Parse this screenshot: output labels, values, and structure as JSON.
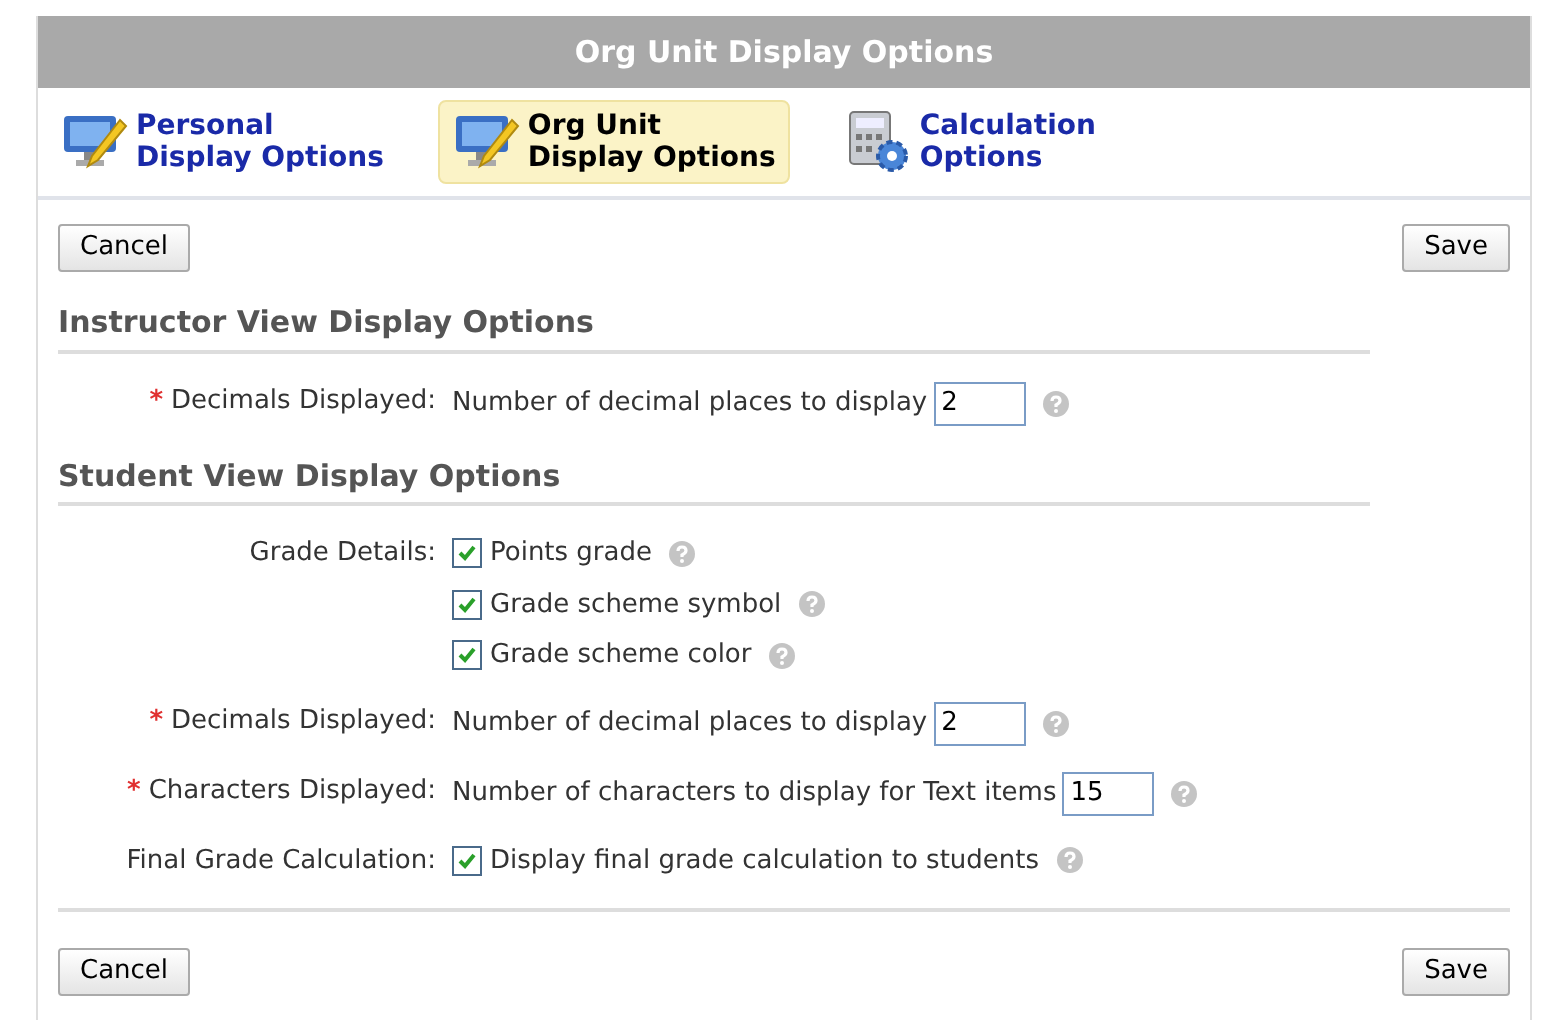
{
  "window": {
    "title": "Org Unit Display Options"
  },
  "tabs": [
    {
      "lines": [
        "Personal",
        "Display Options"
      ],
      "kind": "display",
      "selected": false
    },
    {
      "lines": [
        "Org Unit",
        "Display Options"
      ],
      "kind": "display",
      "selected": true
    },
    {
      "lines": [
        "Calculation",
        "Options"
      ],
      "kind": "calculator",
      "selected": false
    }
  ],
  "top_buttons": [
    "Cancel",
    "Save"
  ],
  "sections": [
    {
      "heading": "Instructor View Display Options",
      "rows": [
        {
          "kind": "input",
          "mark": "*",
          "label": "Decimals Displayed:",
          "text": "Number of decimal places to display",
          "value": "2"
        }
      ]
    },
    {
      "heading": "Student View Display Options",
      "rows": [
        {
          "kind": "checks",
          "label": "Grade Details:",
          "items": [
            {
              "label": "Points grade",
              "checked": true
            },
            {
              "label": "Grade scheme symbol",
              "checked": true
            },
            {
              "label": "Grade scheme color",
              "checked": true
            }
          ]
        },
        {
          "kind": "input",
          "mark": "*",
          "label": "Decimals Displayed:",
          "text": "Number of decimal places to display",
          "value": "2"
        },
        {
          "kind": "input",
          "mark": "*",
          "label": "Characters Displayed:",
          "text": "Number of characters to display for Text items",
          "value": "15"
        },
        {
          "kind": "checks",
          "label": "Final Grade Calculation:",
          "items": [
            {
              "label": "Display final grade calculation to students",
              "checked": true
            }
          ]
        }
      ]
    }
  ],
  "bottom_buttons": [
    "Cancel",
    "Save"
  ]
}
